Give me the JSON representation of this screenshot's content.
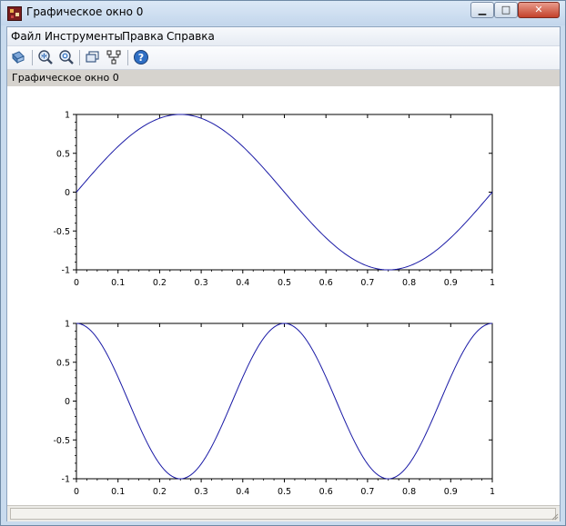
{
  "window": {
    "title": "Графическое окно 0",
    "min_label": "▁",
    "max_label": "□",
    "close_label": "✕"
  },
  "menubar": {
    "items": [
      {
        "label": "Файл"
      },
      {
        "label": "Инструменты"
      },
      {
        "label": "Правка"
      },
      {
        "label": "Справка"
      }
    ]
  },
  "toolbar": {
    "icons": [
      "rotate-icon",
      "zoom-in-icon",
      "zoom-out-icon",
      "datatip-icon",
      "editor-icon",
      "help-icon"
    ]
  },
  "infobar": {
    "text": "Графическое окно 0"
  },
  "colors": {
    "curve": "#1a1aa6",
    "axis": "#000000",
    "info_bg": "#d6d3ce"
  },
  "chart_data": [
    {
      "type": "line",
      "title": "",
      "xlabel": "",
      "ylabel": "",
      "xlim": [
        0,
        1
      ],
      "ylim": [
        -1,
        1
      ],
      "x_ticks": [
        "0",
        "0.1",
        "0.2",
        "0.3",
        "0.4",
        "0.5",
        "0.6",
        "0.7",
        "0.8",
        "0.9",
        "1"
      ],
      "y_ticks": [
        "-1",
        "-0.5",
        "0",
        "0.5",
        "1"
      ],
      "grid": false,
      "series": [
        {
          "function": "sin(2πx)",
          "samples": 201
        }
      ]
    },
    {
      "type": "line",
      "title": "",
      "xlabel": "",
      "ylabel": "",
      "xlim": [
        0,
        1
      ],
      "ylim": [
        -1,
        1
      ],
      "x_ticks": [
        "0",
        "0.1",
        "0.2",
        "0.3",
        "0.4",
        "0.5",
        "0.6",
        "0.7",
        "0.8",
        "0.9",
        "1"
      ],
      "y_ticks": [
        "-1",
        "-0.5",
        "0",
        "0.5",
        "1"
      ],
      "grid": false,
      "series": [
        {
          "function": "cos(4πx)",
          "samples": 201
        }
      ]
    }
  ]
}
